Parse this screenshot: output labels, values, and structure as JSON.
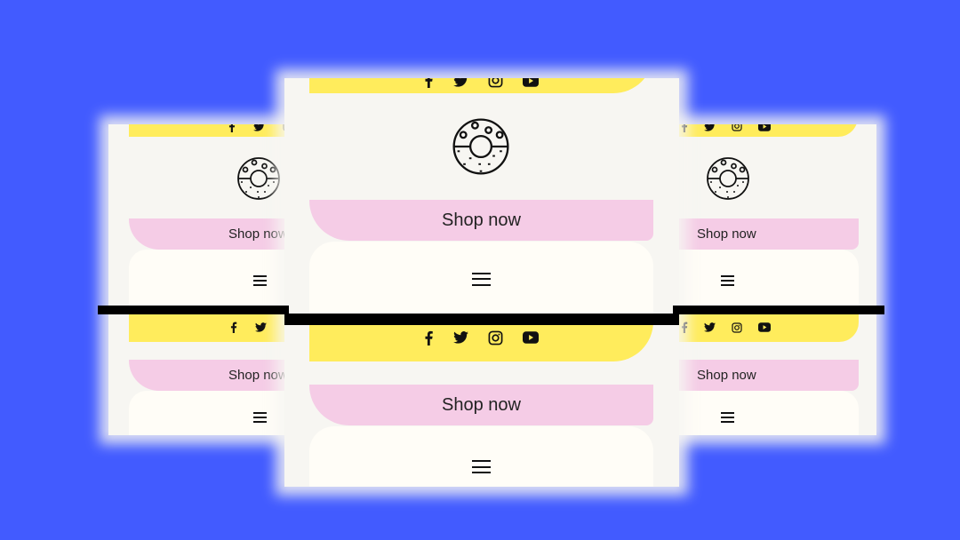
{
  "background_color": "#425bff",
  "colors": {
    "social_bar": "#ffec5c",
    "shop_button": "#f5cce6",
    "menu_card": "#fffdf7",
    "page": "#f7f6f2"
  },
  "social_icons": [
    "facebook-icon",
    "twitter-icon",
    "instagram-icon",
    "youtube-icon"
  ],
  "mockups": {
    "left": {
      "top_section": {
        "shop_label": "Shop now",
        "logo": "donut-icon",
        "menu": "hamburger-menu-icon"
      },
      "bottom_section": {
        "shop_label": "Shop now",
        "menu": "hamburger-menu-icon"
      }
    },
    "center": {
      "top_section": {
        "shop_label": "Shop now",
        "logo": "donut-icon",
        "menu": "hamburger-menu-icon"
      },
      "bottom_section": {
        "shop_label": "Shop now",
        "menu": "hamburger-menu-icon"
      }
    },
    "right": {
      "top_section": {
        "shop_label": "Shop now",
        "logo": "donut-icon",
        "menu": "hamburger-menu-icon"
      },
      "bottom_section": {
        "shop_label": "Shop now",
        "menu": "hamburger-menu-icon"
      }
    }
  }
}
